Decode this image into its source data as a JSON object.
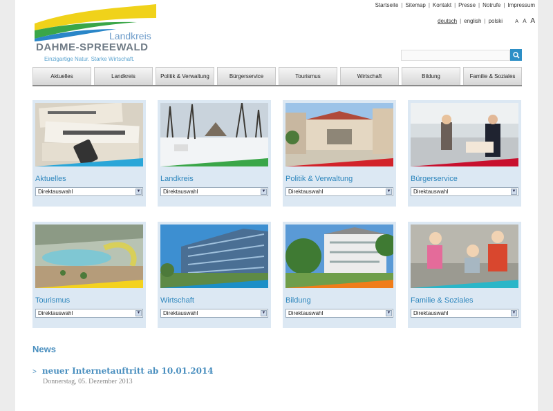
{
  "logo": {
    "landkreis": "Landkreis",
    "title": "DAHME-SPREEWALD",
    "slogan": "Einzigartige Natur. Starke Wirtschaft."
  },
  "top_links": [
    "Startseite",
    "Sitemap",
    "Kontakt",
    "Presse",
    "Notrufe",
    "Impressum"
  ],
  "languages": [
    "deutsch",
    "english",
    "polski"
  ],
  "font_size_controls": [
    "A",
    "A",
    "A"
  ],
  "search": {
    "placeholder": ""
  },
  "nav": [
    "Aktuelles",
    "Landkreis",
    "Politik & Verwaltung",
    "Bürgerservice",
    "Tourismus",
    "Wirtschaft",
    "Bildung",
    "Familie & Soziales"
  ],
  "tiles": [
    {
      "title": "Aktuelles",
      "select": "Direktauswahl",
      "accent": "#2aa6d8"
    },
    {
      "title": "Landkreis",
      "select": "Direktauswahl",
      "accent": "#3aa648"
    },
    {
      "title": "Politik & Verwaltung",
      "select": "Direktauswahl",
      "accent": "#d2232a"
    },
    {
      "title": "Bürgerservice",
      "select": "Direktauswahl",
      "accent": "#c8102e"
    },
    {
      "title": "Tourismus",
      "select": "Direktauswahl",
      "accent": "#f4d21f"
    },
    {
      "title": "Wirtschaft",
      "select": "Direktauswahl",
      "accent": "#1c8fc7"
    },
    {
      "title": "Bildung",
      "select": "Direktauswahl",
      "accent": "#f07d1a"
    },
    {
      "title": "Familie & Soziales",
      "select": "Direktauswahl",
      "accent": "#2ab6c8"
    }
  ],
  "news": {
    "heading": "News",
    "items": [
      {
        "title": "neuer Internetauftritt ab 10.01.2014",
        "date": "Donnerstag, 05. Dezember 2013"
      }
    ]
  },
  "colors": {
    "brand_blue": "#2d86bd",
    "tile_bg": "#dce8f3",
    "logo_yellow": "#f0d21a",
    "logo_green": "#3aa648"
  }
}
